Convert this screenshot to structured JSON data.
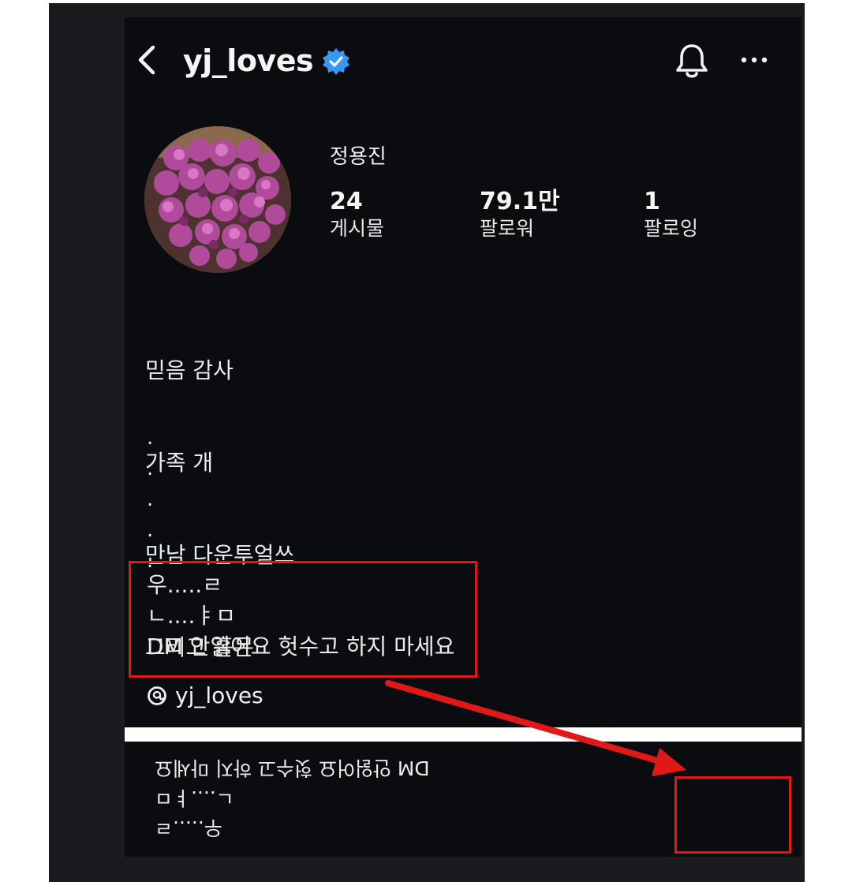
{
  "header": {
    "username": "yj_loves",
    "back_icon": "chevron-left-icon",
    "verified_icon": "verified-badge-icon",
    "notification_icon": "bell-icon",
    "more_icon": "more-horizontal-icon"
  },
  "profile": {
    "display_name": "정용진",
    "stats": [
      {
        "value": "24",
        "label": "게시물"
      },
      {
        "value": "79.1만",
        "label": "팔로워"
      },
      {
        "value": "1",
        "label": "팔로잉"
      }
    ],
    "bio_lines": [
      "믿음 감사",
      "가족 개",
      "만남 다운투얼쓰",
      "그리고 홀몬"
    ],
    "dots": [
      ".",
      ".",
      ".",
      ".",
      "."
    ],
    "highlighted_lines": [
      "우.....ㄹ",
      "ㄴ....ㅑㅁ",
      "DM 안읽어요 헛수고 하지 마세요"
    ],
    "threads_handle": "yj_loves",
    "threads_icon": "threads-icon"
  },
  "flipped": {
    "lines": [
      "우.....ㄹ",
      "ㄴ....ㅑㅁ",
      "DM 안읽어요 헛수고 하지 마세요"
    ]
  },
  "annotation": {
    "color": "#e01818"
  },
  "colors": {
    "verified": "#3897f0",
    "background": "#0b0c10"
  }
}
